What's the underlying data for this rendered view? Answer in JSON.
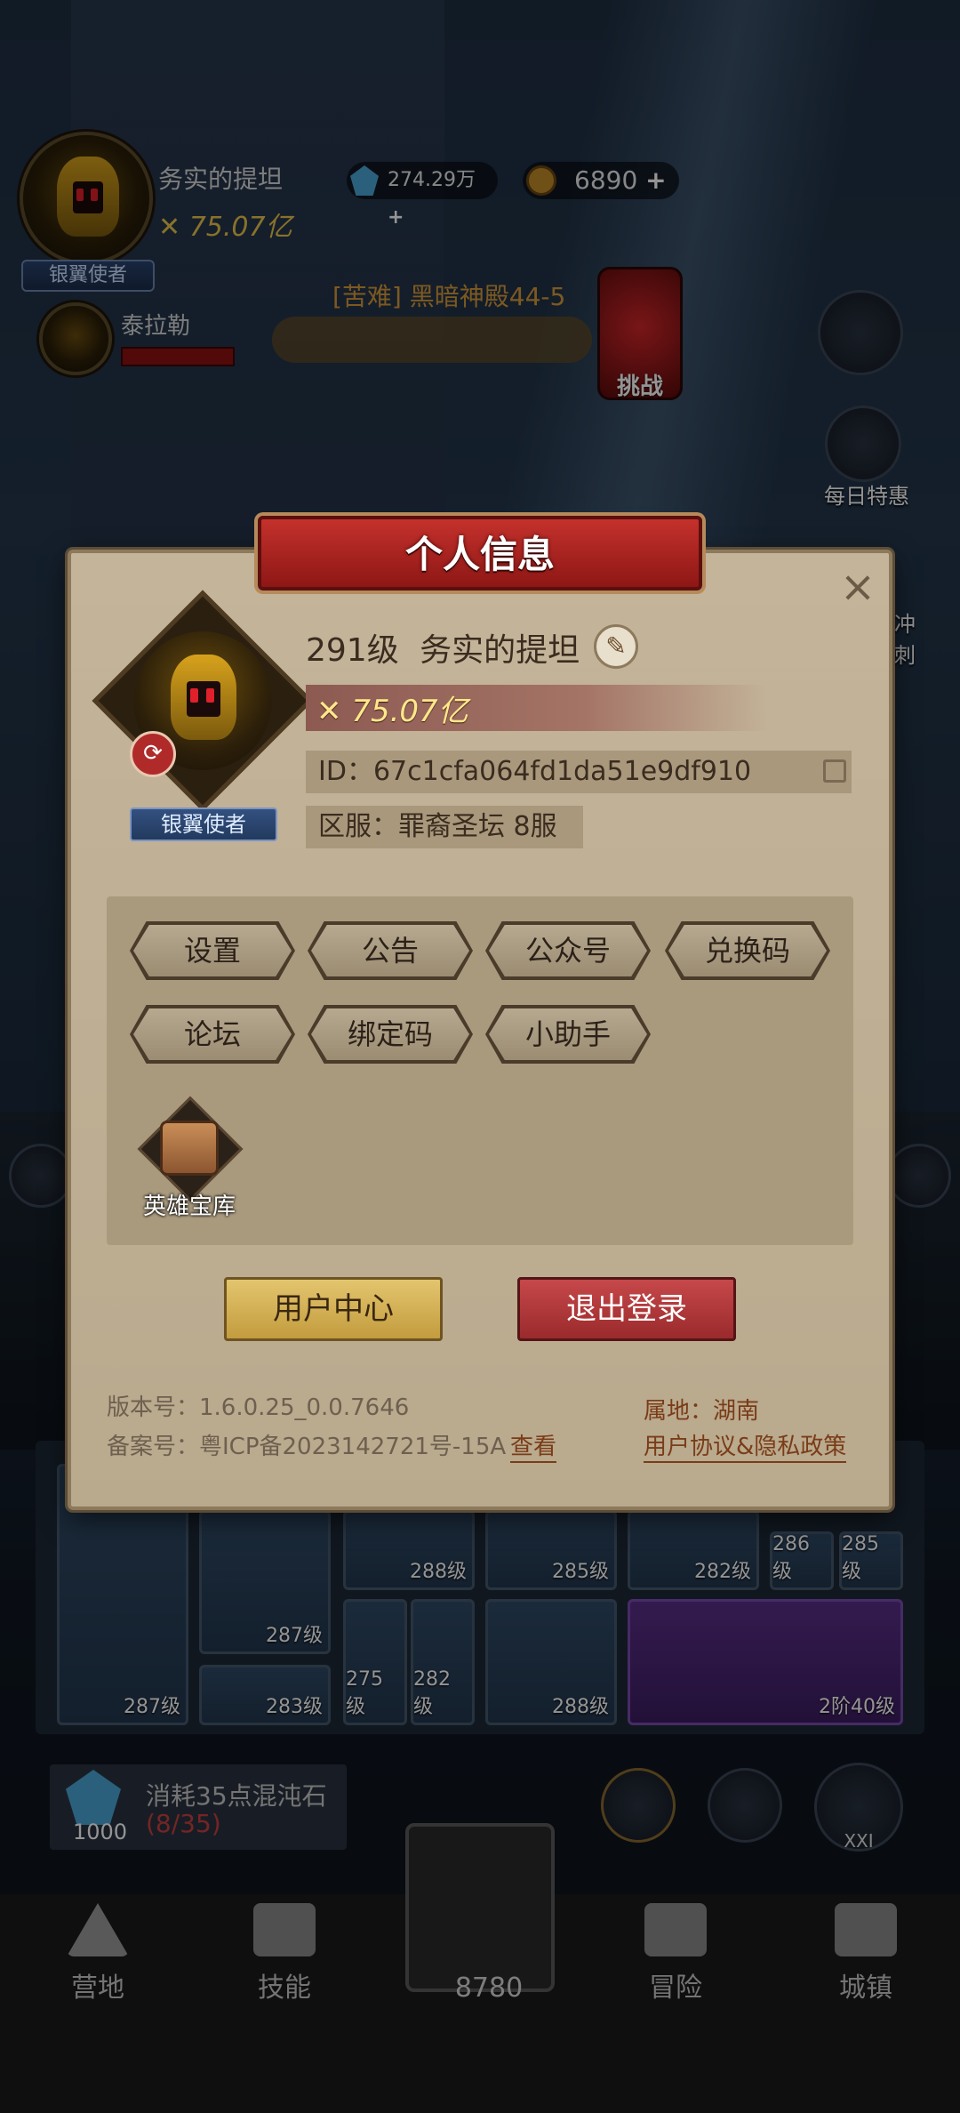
{
  "hud": {
    "player_name": "务实的提坦",
    "power": "75.07亿",
    "rank_badge": "银翼使者",
    "crystals": "274.29万",
    "coins": "6890",
    "companion_name": "泰拉勒",
    "stage_label": "[苦难] 黑暗神殿44-5",
    "challenge_label": "挑战",
    "daily_deal_label": "每日特惠",
    "sprint_label": "冲刺"
  },
  "equipment": {
    "slot_levels": [
      "287级",
      "287级",
      "288级",
      "285级",
      "282级",
      "286级",
      "285级",
      "283级",
      "275级",
      "282级",
      "288级",
      "2阶40级"
    ],
    "chaos_cost_text": "消耗35点混沌石",
    "chaos_progress": "(8/35)",
    "chaos_stone_count": "1000",
    "rank_button_label": "XXI"
  },
  "nav": {
    "camp": "营地",
    "skills": "技能",
    "battle_count": "8780",
    "adventure": "冒险",
    "town": "城镇"
  },
  "dialog": {
    "title": "个人信息",
    "close": "×",
    "level": "291级",
    "name": "务实的提坦",
    "power": "75.07亿",
    "rank_badge": "银翼使者",
    "id_text": "ID：67c1cfa064fd1da51e9df910",
    "server_text": "区服：罪裔圣坛 8服",
    "menu": [
      "设置",
      "公告",
      "公众号",
      "兑换码",
      "论坛",
      "绑定码",
      "小助手"
    ],
    "hero_vault": "英雄宝库",
    "user_center": "用户中心",
    "logout": "退出登录",
    "version": "版本号：1.6.0.25_0.0.7646",
    "icp": "备案号：粤ICP备2023142721号-15A",
    "icp_view": "查看",
    "region": "属地：湖南",
    "agreement": "用户协议&隐私政策"
  },
  "colors": {
    "dialog_bg": "#c4b49a",
    "title_red": "#c4312c",
    "gold_button": "#e3c56e",
    "red_button": "#c6484a",
    "power_text": "#ffe88a"
  }
}
